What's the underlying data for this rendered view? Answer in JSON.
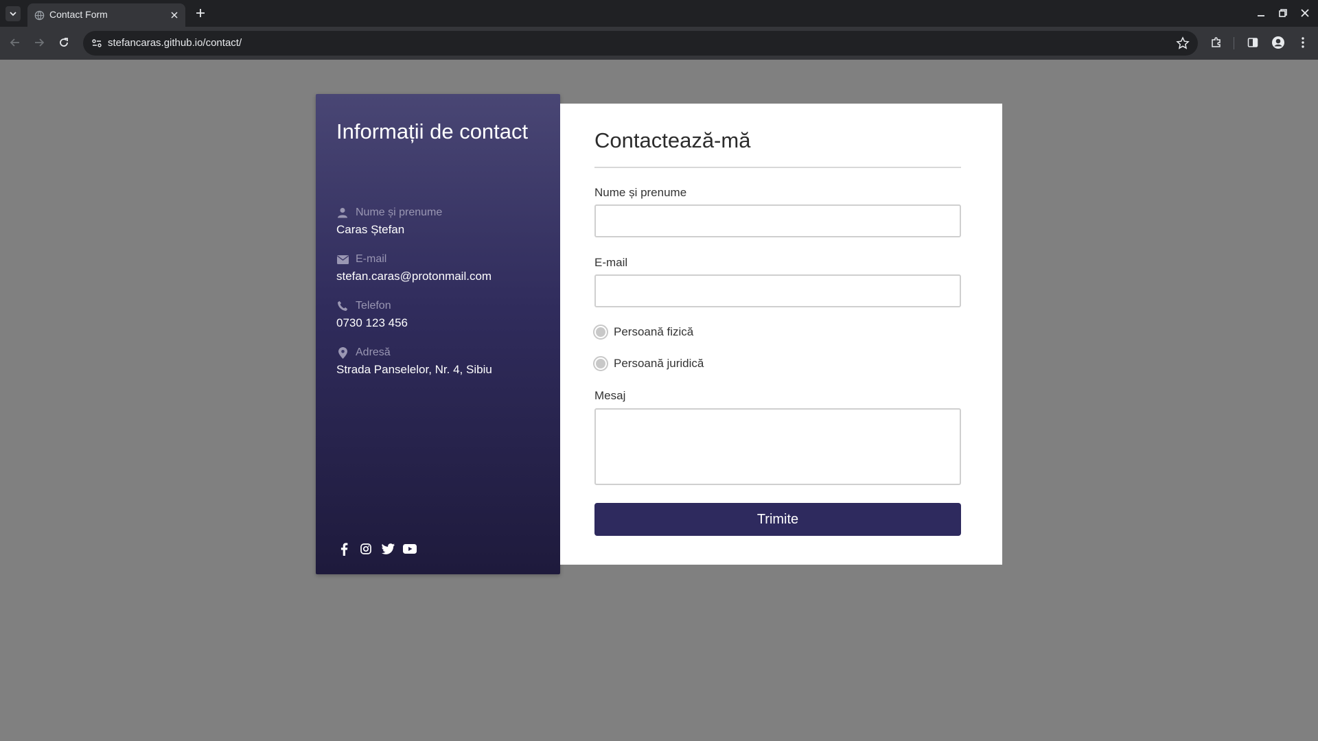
{
  "browser": {
    "tab_title": "Contact Form",
    "url": "stefancaras.github.io/contact/"
  },
  "info": {
    "title": "Informații de contact",
    "items": [
      {
        "icon": "user-icon",
        "label": "Nume și prenume",
        "value": "Caras Ștefan"
      },
      {
        "icon": "envelope-icon",
        "label": "E-mail",
        "value": "stefan.caras@protonmail.com"
      },
      {
        "icon": "phone-icon",
        "label": "Telefon",
        "value": "0730 123 456"
      },
      {
        "icon": "map-pin-icon",
        "label": "Adresă",
        "value": "Strada Panselelor, Nr. 4, Sibiu"
      }
    ],
    "socials": [
      "facebook-icon",
      "instagram-icon",
      "twitter-icon",
      "youtube-icon"
    ]
  },
  "form": {
    "title": "Contactează-mă",
    "name_label": "Nume și prenume",
    "name_value": "",
    "email_label": "E-mail",
    "email_value": "",
    "radio_options": [
      "Persoană fizică",
      "Persoană juridică"
    ],
    "message_label": "Mesaj",
    "message_value": "",
    "submit_label": "Trimite"
  },
  "colors": {
    "page_bg": "#808080",
    "panel_gradient_top": "#494674",
    "panel_gradient_bottom": "#1e1a3c",
    "button_bg": "#2e2a5e"
  }
}
